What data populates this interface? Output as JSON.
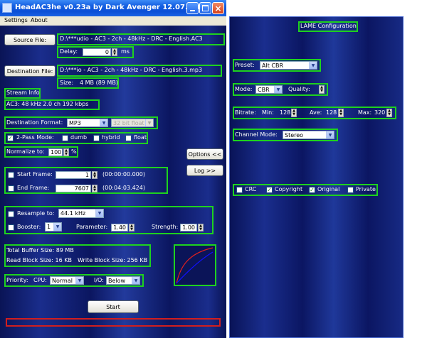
{
  "main": {
    "title": "HeadAC3he v0.23a by Dark Avenger 12.07.2002",
    "menu": [
      "Settings",
      "About"
    ],
    "source_label": "Source File:",
    "source_path": "D:\\***udio - AC3 - 2ch - 48kHz - DRC - English.AC3",
    "delay_label": "Delay:",
    "delay_value": "0",
    "delay_unit": "ms",
    "destination_label": "Destination File:",
    "destination_path": "D:\\***io - AC3 - 2ch - 48kHz - DRC - English.3.mp3",
    "size_label": "Size:",
    "size_value": "4 MB (89 MB)",
    "stream_info_label": "Stream Info",
    "stream_info_value": "AC3: 48 kHz  2.0 ch  192 kbps",
    "dest_format_label": "Destination Format:",
    "dest_format_value": "MP3",
    "bit_format_value": "32 bit float",
    "twopass_label": "2-Pass Mode:",
    "twopass_options": [
      "dumb",
      "hybrid",
      "float"
    ],
    "normalize_label": "Normalize to:",
    "normalize_value": "100",
    "normalize_unit": "%",
    "options_button": "Options <<",
    "log_button": "Log >>",
    "start_frame_label": "Start Frame:",
    "start_frame_value": "1",
    "start_frame_time": "(00:00:00.000)",
    "end_frame_label": "End Frame:",
    "end_frame_value": "7607",
    "end_frame_time": "(00:04:03.424)",
    "resample_label": "Resample to:",
    "resample_value": "44.1 kHz",
    "booster_label": "Booster:",
    "booster_value": "1",
    "parameter_label": "Parameter:",
    "parameter_value": "1.40",
    "strength_label": "Strength:",
    "strength_value": "1.00",
    "total_buffer": "Total Buffer Size:  89 MB",
    "read_block": "Read Block Size:  16 KB",
    "write_block": "Write Block Size:  256 KB",
    "priority_label": "Priority:",
    "cpu_label": "CPU:",
    "cpu_value": "Normal",
    "io_label": "I/O:",
    "io_value": "Below",
    "start_button": "Start"
  },
  "lame": {
    "title": "LAME Configuration",
    "preset_label": "Preset:",
    "preset_value": "Alt CBR",
    "mode_label": "Mode:",
    "mode_value": "CBR",
    "quality_label": "Quality:",
    "quality_value": "",
    "bitrate_label": "Bitrate:",
    "min_label": "Min:",
    "min_value": "128",
    "ave_label": "Ave:",
    "ave_value": "128",
    "max_label": "Max:",
    "max_value": "320",
    "channel_mode_label": "Channel Mode:",
    "channel_mode_value": "Stereo",
    "flags": [
      {
        "label": "CRC",
        "checked": false
      },
      {
        "label": "Copyright",
        "checked": true
      },
      {
        "label": "Original",
        "checked": true
      },
      {
        "label": "Private",
        "checked": false
      }
    ]
  },
  "colors": {
    "group_border": "#1ed21e",
    "progress_border": "#d21e1e",
    "window_bg": "#0f1c6a",
    "curve_red": "#e02020",
    "curve_blue": "#1010ff"
  }
}
